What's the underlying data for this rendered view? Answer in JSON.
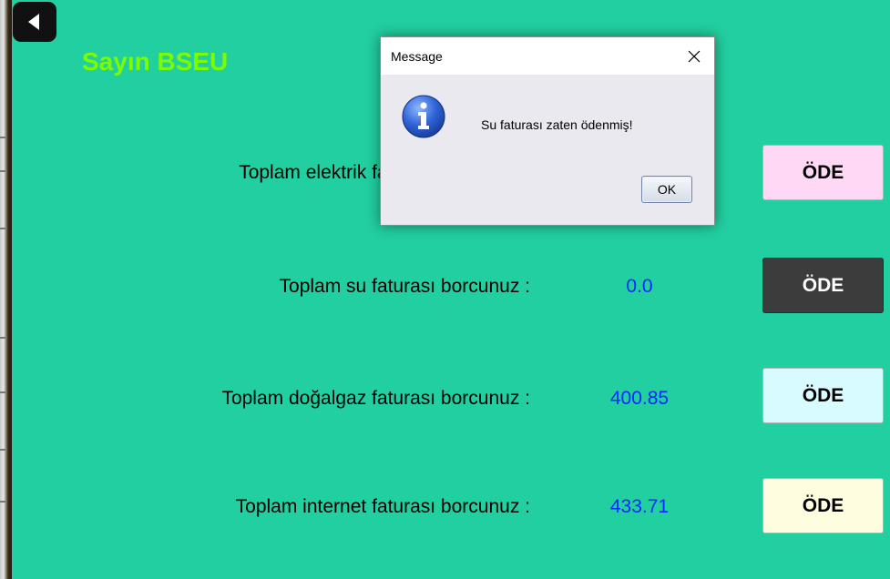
{
  "greeting": "Sayın BSEU",
  "bills": [
    {
      "label": "Toplam elektrik faturası borcunuz :",
      "value": "",
      "button": "ÖDE",
      "button_color": "#ffd8f6"
    },
    {
      "label": "Toplam su faturası borcunuz :",
      "value": "0.0",
      "button": "ÖDE",
      "button_color": "#3c3c3c"
    },
    {
      "label": "Toplam doğalgaz faturası borcunuz :",
      "value": "400.85",
      "button": "ÖDE",
      "button_color": "#d8fbff"
    },
    {
      "label": "Toplam internet faturası borcunuz :",
      "value": "433.71",
      "button": "ÖDE",
      "button_color": "#fffde0"
    }
  ],
  "dialog": {
    "title": "Message",
    "message": "Su faturası zaten ödenmiş!",
    "ok_label": "OK",
    "icon": "info-icon"
  },
  "colors": {
    "background": "#22cfa0",
    "greeting": "#7cfc00",
    "value": "#0a28ff"
  }
}
